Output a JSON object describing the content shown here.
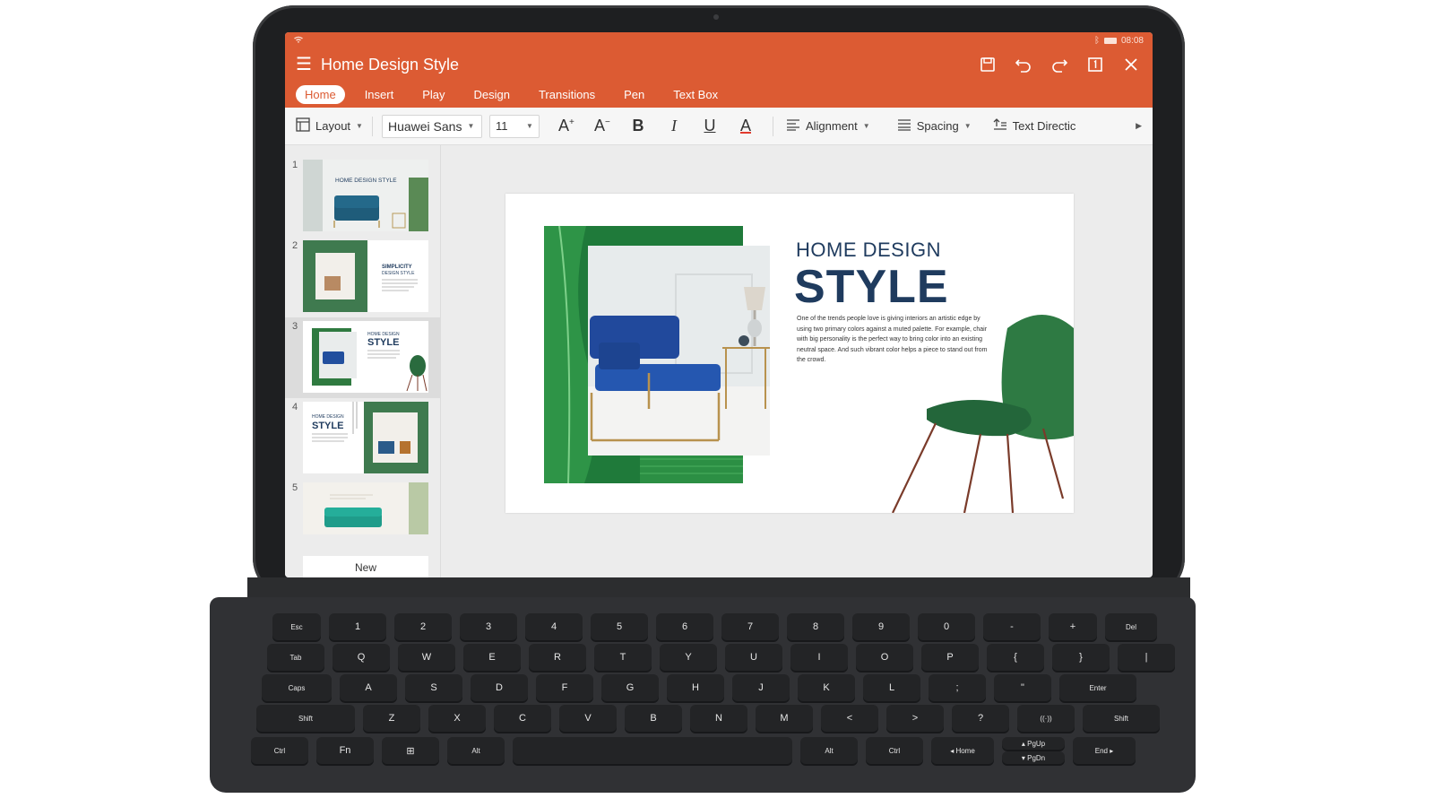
{
  "app": {
    "title": "Home Design Style",
    "status_time": "08:08",
    "accent": "#dc5b33"
  },
  "tabs": [
    "Home",
    "Insert",
    "Play",
    "Design",
    "Transitions",
    "Pen",
    "Text Box"
  ],
  "toolbar": {
    "layout": "Layout",
    "font": "Huawei Sans",
    "size": "11",
    "alignment": "Alignment",
    "spacing": "Spacing",
    "text_direction": "Text Directic"
  },
  "thumbnails": {
    "numbers": [
      "1",
      "2",
      "3",
      "4",
      "5"
    ],
    "t1": "HOME DESIGN STYLE",
    "t2a": "SIMPLICITY",
    "t2b": "DESIGN STYLE",
    "t3a": "HOME DESIGN",
    "t3b": "STYLE",
    "t4a": "HOME DESIGN",
    "t4b": "STYLE",
    "new": "New"
  },
  "slide": {
    "kicker": "HOME DESIGN",
    "title": "STYLE",
    "body": "One of the trends people love is giving interiors an artistic edge by using two primary colors against a muted palette. For example, chair with big personality is the perfect way to bring color into an existing neutral space. And such vibrant color helps a piece to stand out from the crowd."
  },
  "keyboard": {
    "row1": [
      "Esc",
      "1",
      "2",
      "3",
      "4",
      "5",
      "6",
      "7",
      "8",
      "9",
      "0",
      "-",
      "+",
      "Del"
    ],
    "row2": [
      "Tab",
      "Q",
      "W",
      "E",
      "R",
      "T",
      "Y",
      "U",
      "I",
      "O",
      "P",
      "{",
      "}",
      "|"
    ],
    "row3": [
      "Caps",
      "A",
      "S",
      "D",
      "F",
      "G",
      "H",
      "J",
      "K",
      "L",
      ";",
      "\"",
      "Enter"
    ],
    "row4": [
      "Shift",
      "Z",
      "X",
      "C",
      "V",
      "B",
      "N",
      "M",
      "<",
      ">",
      "?",
      "((·))",
      "Shift"
    ],
    "row5": [
      "Ctrl",
      "Fn",
      "⊞",
      "Alt",
      "",
      "Alt",
      "Ctrl",
      "◂ Home",
      "▴ PgUp",
      "▾ PgDn",
      "End ▸"
    ]
  }
}
